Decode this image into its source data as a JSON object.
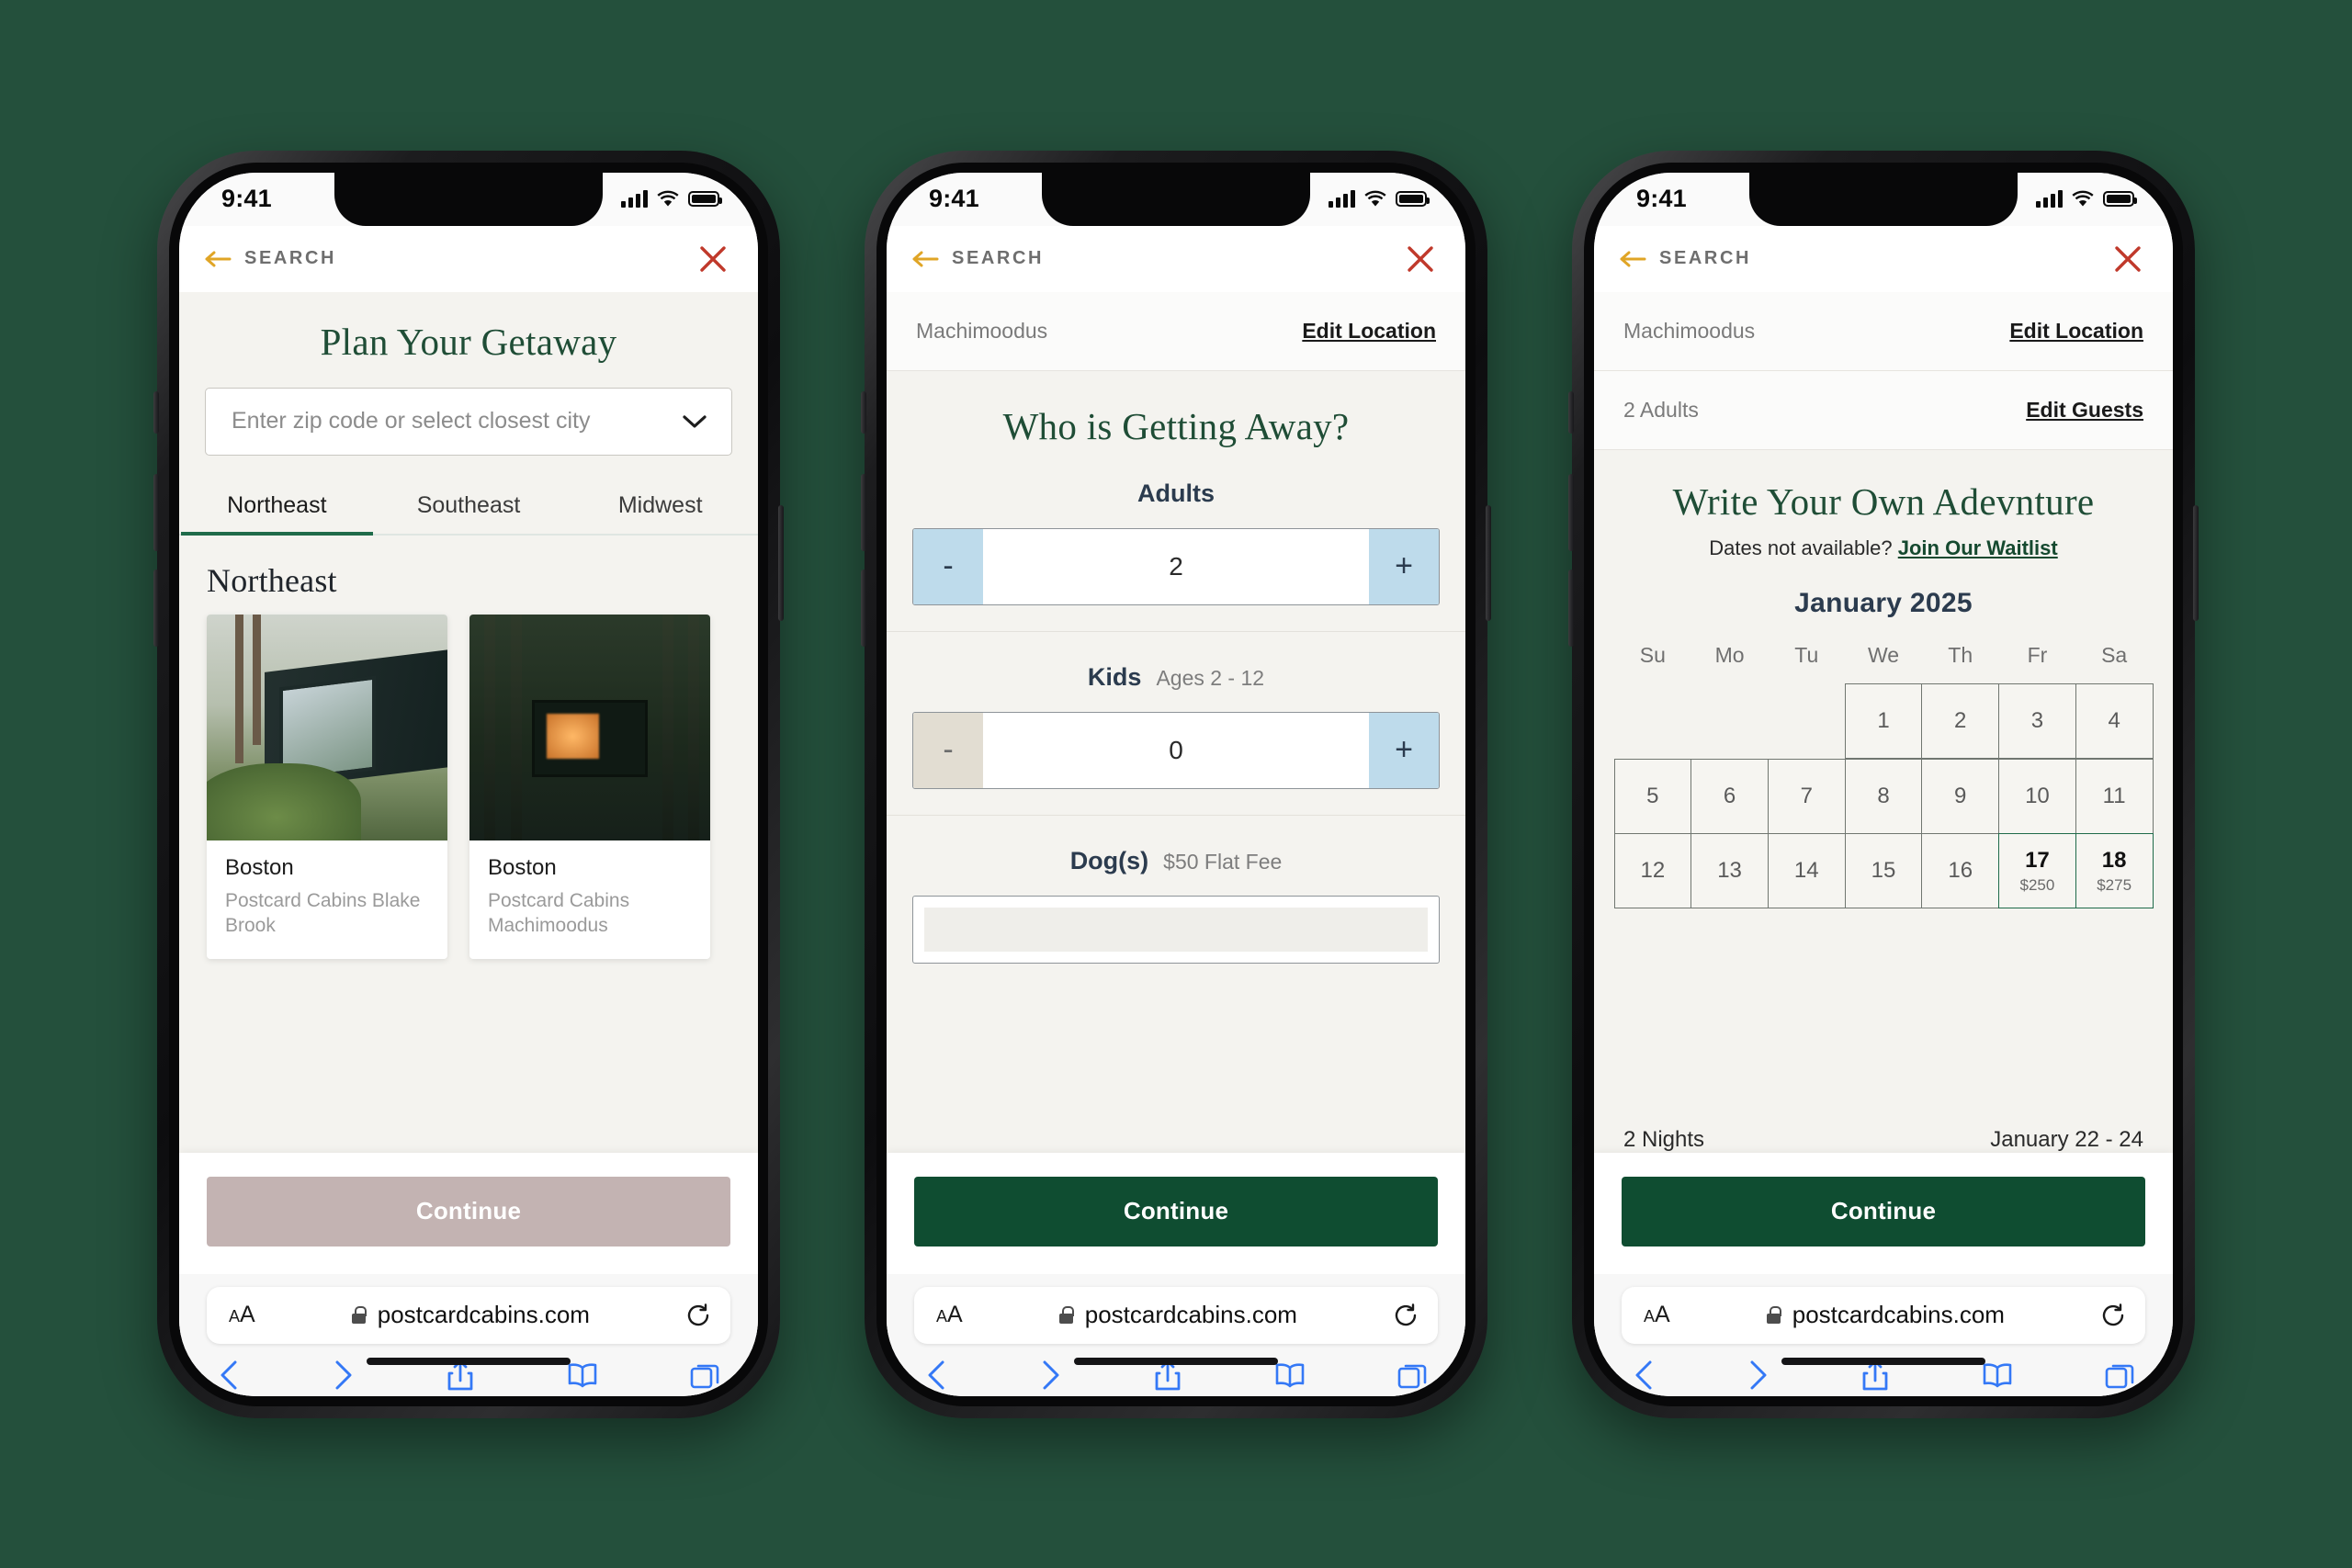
{
  "brand": {
    "page_bg": "#24503c",
    "green": "#0f4d31",
    "accent_yellow": "#e0a526",
    "close_red": "#c0392b",
    "disabled_button": "#c3b3b2",
    "stepper_blue": "#bedbeb",
    "stepper_beige": "#e2ddd2"
  },
  "status_bar": {
    "time": "9:41",
    "signal_icon": "cellular-bars-icon",
    "wifi_icon": "wifi-icon",
    "battery_icon": "battery-icon"
  },
  "app_nav": {
    "back_icon": "back-arrow-icon",
    "back_label": "SEARCH",
    "close_icon": "close-x-icon"
  },
  "browser": {
    "text_size_label": "AA",
    "lock_icon": "lock-icon",
    "url": "postcardcabins.com",
    "reload_icon": "reload-icon",
    "toolbar": [
      "back-chevron-icon",
      "forward-chevron-icon",
      "share-icon",
      "bookmarks-icon",
      "tabs-icon"
    ]
  },
  "phone1": {
    "title": "Plan Your Getaway",
    "zip_input": {
      "placeholder": "Enter zip code or select closest city",
      "value": "",
      "chevron_icon": "chevron-down-icon"
    },
    "tabs": [
      {
        "label": "Northeast",
        "active": true
      },
      {
        "label": "Southeast",
        "active": false
      },
      {
        "label": "Midwest",
        "active": false
      }
    ],
    "section_heading": "Northeast",
    "cards": [
      {
        "city": "Boston",
        "property": "Postcard Cabins Blake Brook",
        "art": "cab1"
      },
      {
        "city": "Boston",
        "property": "Postcard Cabins Machimoodus",
        "art": "cab2"
      }
    ],
    "continue_label": "Continue",
    "continue_enabled": false
  },
  "phone2": {
    "location_row": {
      "value": "Machimoodus",
      "action": "Edit Location"
    },
    "title": "Who is Getting Away?",
    "steppers": [
      {
        "name": "Adults",
        "hint": "",
        "value": "2",
        "minus": "-",
        "plus": "+",
        "minus_enabled": true,
        "plus_enabled": true
      },
      {
        "name": "Kids",
        "hint": "Ages 2 - 12",
        "value": "0",
        "minus": "-",
        "plus": "+",
        "minus_enabled": false,
        "plus_enabled": true
      },
      {
        "name": "Dog(s)",
        "hint": "$50 Flat Fee",
        "value": "",
        "minus": "-",
        "plus": "+",
        "minus_enabled": false,
        "plus_enabled": true
      }
    ],
    "continue_label": "Continue",
    "continue_enabled": true
  },
  "phone3": {
    "location_row": {
      "value": "Machimoodus",
      "action": "Edit Location"
    },
    "guests_row": {
      "value": "2 Adults",
      "action": "Edit Guests"
    },
    "title": "Write Your Own Adevnture",
    "waitlist_prefix": "Dates not available?",
    "waitlist_link": "Join Our Waitlist",
    "month": "January 2025",
    "dow": [
      "Su",
      "Mo",
      "Tu",
      "We",
      "Th",
      "Fr",
      "Sa"
    ],
    "first_day_index": 3,
    "days": [
      {
        "n": "1"
      },
      {
        "n": "2"
      },
      {
        "n": "3"
      },
      {
        "n": "4"
      },
      {
        "n": "5"
      },
      {
        "n": "6"
      },
      {
        "n": "7"
      },
      {
        "n": "8"
      },
      {
        "n": "9"
      },
      {
        "n": "10"
      },
      {
        "n": "11"
      },
      {
        "n": "12"
      },
      {
        "n": "13"
      },
      {
        "n": "14"
      },
      {
        "n": "15"
      },
      {
        "n": "16"
      },
      {
        "n": "17",
        "price": "$250",
        "selected": true
      },
      {
        "n": "18",
        "price": "$275",
        "selected": true
      }
    ],
    "summary_nights": "2 Nights",
    "summary_dates": "January 22 - 24",
    "continue_label": "Continue",
    "continue_enabled": true
  }
}
